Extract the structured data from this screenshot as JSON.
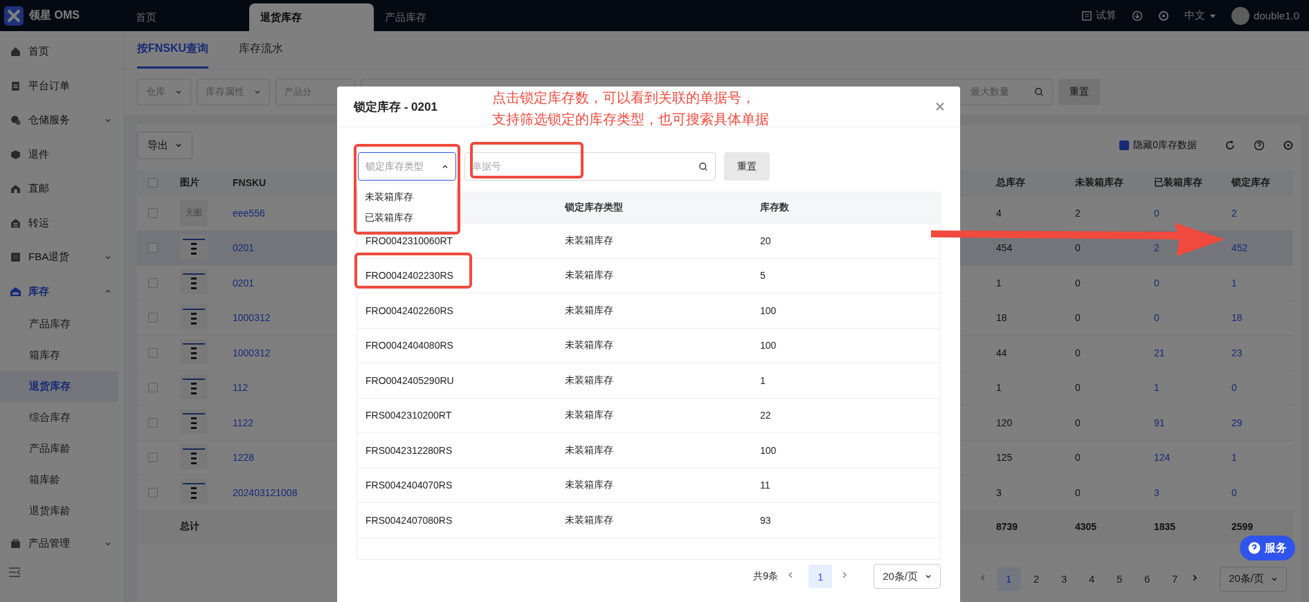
{
  "app": {
    "logo_text": "领星 OMS"
  },
  "top_tabs": [
    {
      "label": "首页",
      "selected": false
    },
    {
      "label": "退货库存",
      "selected": true
    },
    {
      "label": "产品库存",
      "selected": false
    }
  ],
  "header_actions": {
    "trial": "试算",
    "language": "中文",
    "user": "double1.0"
  },
  "sidebar": {
    "items": [
      {
        "label": "首页",
        "expandable": false
      },
      {
        "label": "平台订单",
        "expandable": false
      },
      {
        "label": "仓储服务",
        "expandable": true,
        "expanded": false
      },
      {
        "label": "退件",
        "expandable": false
      },
      {
        "label": "直邮",
        "expandable": false
      },
      {
        "label": "转运",
        "expandable": false
      },
      {
        "label": "FBA退货",
        "expandable": true,
        "expanded": false
      },
      {
        "label": "库存",
        "expandable": true,
        "expanded": true,
        "children": [
          {
            "label": "产品库存",
            "selected": false
          },
          {
            "label": "箱库存",
            "selected": false
          },
          {
            "label": "退货库存",
            "selected": true
          },
          {
            "label": "综合库存",
            "selected": false
          },
          {
            "label": "产品库龄",
            "selected": false
          },
          {
            "label": "箱库龄",
            "selected": false
          },
          {
            "label": "退货库龄",
            "selected": false
          }
        ]
      },
      {
        "label": "产品管理",
        "expandable": true,
        "expanded": false
      }
    ]
  },
  "subtabs": [
    {
      "label": "按FNSKU查询",
      "selected": true
    },
    {
      "label": "库存流水",
      "selected": false
    }
  ],
  "filters": {
    "dropdowns": [
      "仓库",
      "库存属性"
    ],
    "partial_dropdown": "产品分",
    "max_quantity_placeholder": "最大数量",
    "reset": "重置"
  },
  "toolbar": {
    "export": "导出",
    "hide_zero": {
      "label": "隐藏0库存数据",
      "checked": true
    }
  },
  "table": {
    "select_all": {
      "checked": false
    },
    "columns_left": [
      "图片",
      "FNSKU"
    ],
    "columns_right": [
      "总库存",
      "未装箱库存",
      "已装箱库存",
      "锁定库存"
    ],
    "rows": [
      {
        "image": {
          "kind": "none",
          "text": "无图"
        },
        "fnsku": "eee556",
        "values": [
          "4",
          "2",
          "0",
          "2"
        ],
        "checked": false,
        "selected": false
      },
      {
        "image": {
          "kind": "thumb"
        },
        "fnsku": "0201",
        "values": [
          "454",
          "0",
          "2",
          "452"
        ],
        "checked": false,
        "selected": true
      },
      {
        "image": {
          "kind": "thumb"
        },
        "fnsku": "0201",
        "values": [
          "1",
          "0",
          "0",
          "1"
        ],
        "checked": false,
        "selected": false
      },
      {
        "image": {
          "kind": "thumb"
        },
        "fnsku": "1000312",
        "values": [
          "18",
          "0",
          "0",
          "18"
        ],
        "checked": false,
        "selected": false
      },
      {
        "image": {
          "kind": "thumb"
        },
        "fnsku": "1000312",
        "values": [
          "44",
          "0",
          "21",
          "23"
        ],
        "checked": false,
        "selected": false
      },
      {
        "image": {
          "kind": "thumb"
        },
        "fnsku": "112",
        "values": [
          "1",
          "0",
          "1",
          "0"
        ],
        "checked": false,
        "selected": false
      },
      {
        "image": {
          "kind": "thumb"
        },
        "fnsku": "1122",
        "values": [
          "120",
          "0",
          "91",
          "29"
        ],
        "checked": false,
        "selected": false
      },
      {
        "image": {
          "kind": "thumb"
        },
        "fnsku": "1228",
        "values": [
          "125",
          "0",
          "124",
          "1"
        ],
        "checked": false,
        "selected": false
      },
      {
        "image": {
          "kind": "thumb"
        },
        "fnsku": "202403121008",
        "values": [
          "3",
          "0",
          "3",
          "0"
        ],
        "checked": false,
        "selected": false
      }
    ],
    "total": {
      "label": "总计",
      "values": [
        "8739",
        "4305",
        "1835",
        "2599"
      ]
    }
  },
  "pagination": {
    "pages": [
      {
        "label": "1",
        "selected": true
      },
      {
        "label": "2",
        "selected": false
      },
      {
        "label": "3",
        "selected": false
      },
      {
        "label": "4",
        "selected": false
      },
      {
        "label": "5",
        "selected": false
      },
      {
        "label": "6",
        "selected": false
      },
      {
        "label": "7",
        "selected": false
      }
    ],
    "page_size": "20条/页"
  },
  "service_button": "服务",
  "modal": {
    "title": "锁定库存 - 0201",
    "type_select": {
      "placeholder": "锁定库存类型",
      "expanded": true,
      "options": [
        "未装箱库存",
        "已装箱库存"
      ]
    },
    "search": {
      "placeholder": "单据号"
    },
    "reset": "重置",
    "columns": [
      "锁定库存类型",
      "库存数"
    ],
    "rows": [
      {
        "code": "FRO0042310060RT",
        "type": "未装箱库存",
        "qty": "20"
      },
      {
        "code": "FRO0042402230RS",
        "type": "未装箱库存",
        "qty": "5"
      },
      {
        "code": "FRO0042402260RS",
        "type": "未装箱库存",
        "qty": "100"
      },
      {
        "code": "FRO0042404080RS",
        "type": "未装箱库存",
        "qty": "100"
      },
      {
        "code": "FRO0042405290RU",
        "type": "未装箱库存",
        "qty": "1"
      },
      {
        "code": "FRS0042310200RT",
        "type": "未装箱库存",
        "qty": "22"
      },
      {
        "code": "FRS0042312280RS",
        "type": "未装箱库存",
        "qty": "100"
      },
      {
        "code": "FRS0042404070RS",
        "type": "未装箱库存",
        "qty": "11"
      },
      {
        "code": "FRS0042407080RS",
        "type": "未装箱库存",
        "qty": "93"
      }
    ],
    "pagination": {
      "total": "共9条",
      "pages": [
        {
          "label": "1",
          "selected": true
        }
      ],
      "page_size": "20条/页"
    }
  },
  "annotation": {
    "lines": [
      "点击锁定库存数，可以看到关联的单据号，",
      "支持筛选锁定的库存类型，也可搜索具体单据"
    ]
  }
}
